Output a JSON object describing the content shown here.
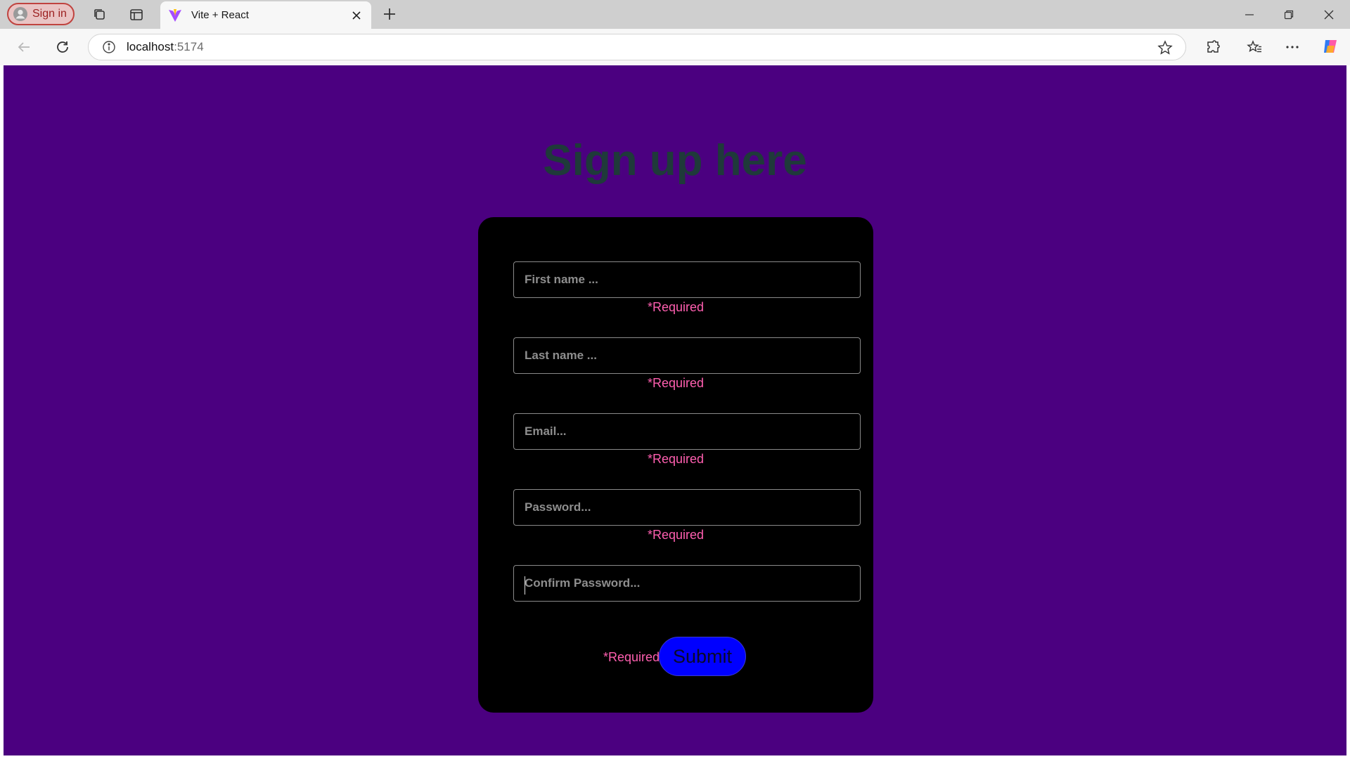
{
  "browser": {
    "profile_label": "Sign in",
    "tab_title": "Vite + React",
    "url_host": "localhost",
    "url_port": ":5174"
  },
  "page": {
    "heading": "Sign up here",
    "fields": {
      "first_name_placeholder": "First name ...",
      "last_name_placeholder": "Last name ...",
      "email_placeholder": "Email...",
      "password_placeholder": "Password...",
      "confirm_password_placeholder": "Confirm Password..."
    },
    "required_text": "*Required",
    "submit_label": "Submit"
  },
  "colors": {
    "page_background": "#4b0080",
    "card_background": "#000000",
    "required_text": "#ff5fb0",
    "submit_button": "#0000ff"
  }
}
